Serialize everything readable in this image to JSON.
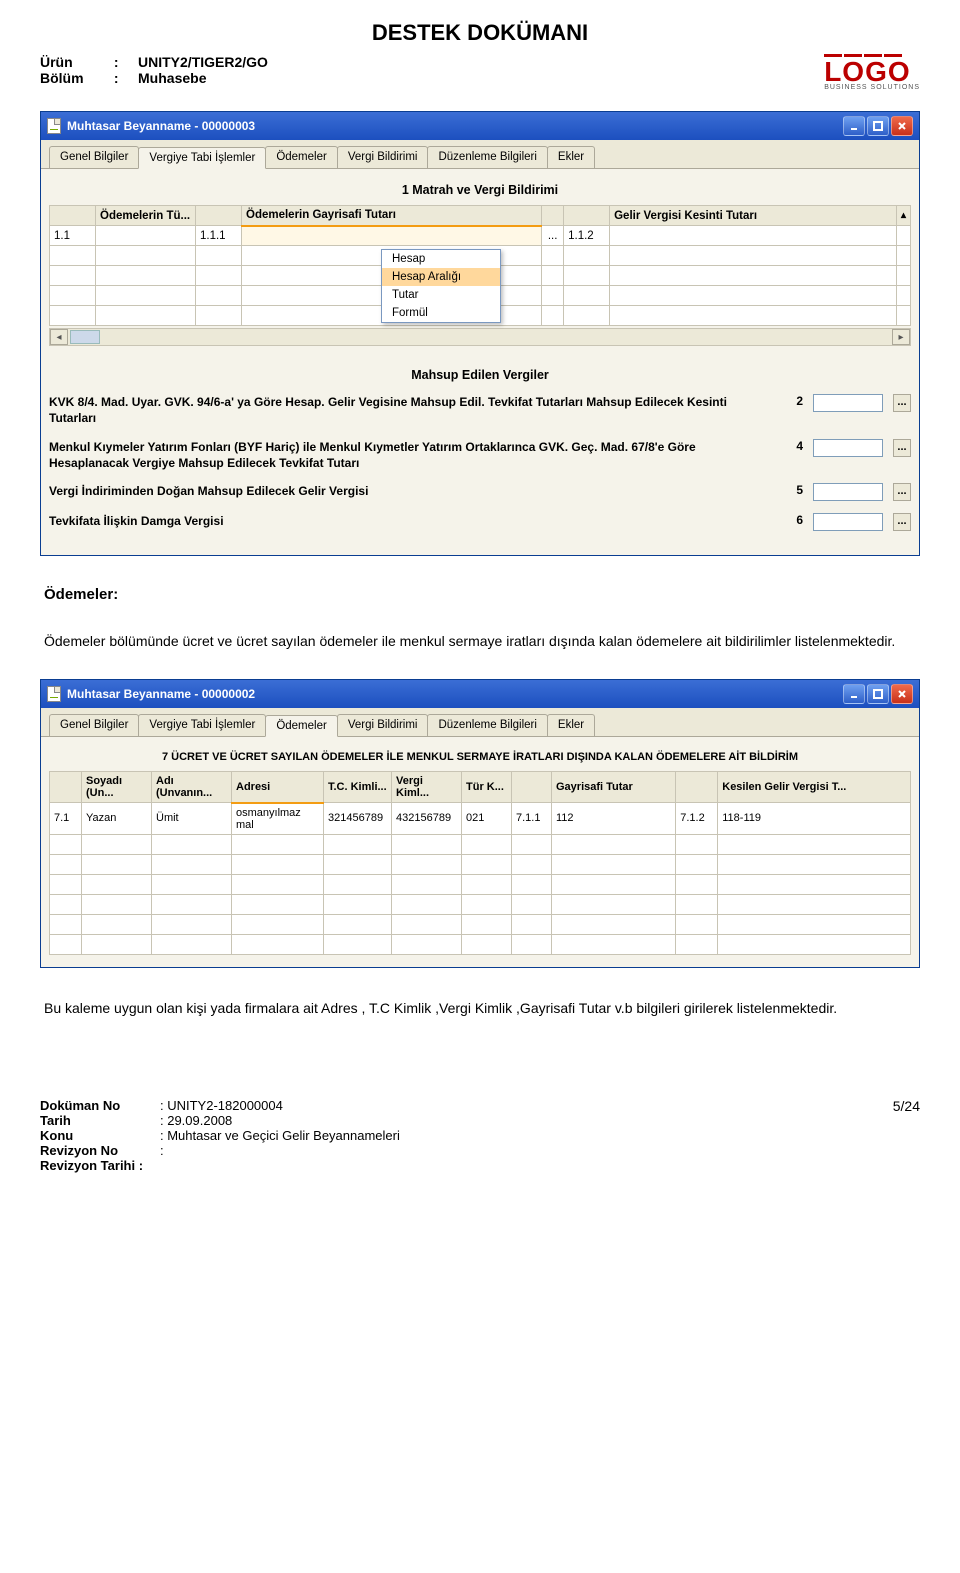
{
  "doc": {
    "title": "DESTEK DOKÜMANI",
    "urun_label": "Ürün",
    "urun_value": "UNITY2/TIGER2/GO",
    "bolum_label": "Bölüm",
    "bolum_value": "Muhasebe",
    "logo_text": "LOGO",
    "logo_sub": "BUSINESS SOLUTIONS"
  },
  "win1": {
    "title": "Muhtasar Beyanname - 00000003",
    "tabs": [
      "Genel Bilgiler",
      "Vergiye Tabi İşlemler",
      "Ödemeler",
      "Vergi Bildirimi",
      "Düzenleme Bilgileri",
      "Ekler"
    ],
    "active_tab_index": 1,
    "section_title": "1 Matrah ve Vergi Bildirimi",
    "columns": [
      "Ödemelerin Tü...",
      "",
      "Ödemelerin Gayrisafi Tutarı",
      "",
      "Gelir Vergisi Kesinti Tutarı"
    ],
    "active_col_index": 2,
    "row1": {
      "c0": "1.1",
      "c1": "1.1.1",
      "c2_right": "...",
      "c3": "1.1.2"
    },
    "context_menu": [
      "Hesap",
      "Hesap Aralığı",
      "Tutar",
      "Formül"
    ],
    "context_selected_index": 1,
    "mahsup_title": "Mahsup Edilen Vergiler",
    "fields": [
      {
        "label": "KVK 8/4. Mad. Uyar. GVK. 94/6-a' ya Göre Hesap. Gelir Vegisine Mahsup Edil. Tevkifat Tutarları Mahsup Edilecek Kesinti Tutarları",
        "num": "2"
      },
      {
        "label": "Menkul Kıymeler Yatırım Fonları (BYF Hariç) ile Menkul Kıymetler Yatırım Ortaklarınca GVK. Geç. Mad. 67/8'e Göre Hesaplanacak Vergiye Mahsup Edilecek Tevkifat Tutarı",
        "num": "4"
      },
      {
        "label": "Vergi İndiriminden Doğan Mahsup Edilecek Gelir Vergisi",
        "num": "5"
      },
      {
        "label": "Tevkifata İlişkin Damga Vergisi",
        "num": "6"
      }
    ]
  },
  "text1": {
    "heading": "Ödemeler:",
    "body": "Ödemeler bölümünde ücret ve ücret sayılan ödemeler ile menkul sermaye iratları dışında kalan ödemelere ait bildirilimler listelenmektedir."
  },
  "win2": {
    "title": "Muhtasar Beyanname - 00000002",
    "tabs": [
      "Genel Bilgiler",
      "Vergiye Tabi İşlemler",
      "Ödemeler",
      "Vergi Bildirimi",
      "Düzenleme Bilgileri",
      "Ekler"
    ],
    "active_tab_index": 2,
    "section_title": "7 ÜCRET VE ÜCRET SAYILAN ÖDEMELER İLE MENKUL SERMAYE İRATLARI DIŞINDA KALAN ÖDEMELERE AİT BİLDİRİM",
    "columns": [
      "",
      "Soyadı (Un...",
      "Adı (Unvanın...",
      "Adresi",
      "T.C. Kimli...",
      "Vergi Kiml...",
      "Tür K...",
      "",
      "Gayrisafi Tutar",
      "",
      "Kesilen Gelir Vergisi T..."
    ],
    "active_col_index": 3,
    "row": {
      "c0": "7.1",
      "c1": "Yazan",
      "c2": "Ümit",
      "c3": "osmanyılmaz mal",
      "c4": "321456789",
      "c5": "432156789",
      "c6": "021",
      "c7": "7.1.1",
      "c8": "112",
      "c9": "7.1.2",
      "c10": "118-119"
    }
  },
  "text2": "Bu kaleme uygun olan kişi yada firmalara ait Adres , T.C Kimlik ,Vergi Kimlik ,Gayrisafi Tutar v.b bilgileri girilerek listelenmektedir.",
  "footer": {
    "dokuman_no_label": "Doküman No",
    "dokuman_no": ": UNITY2-182000004",
    "tarih_label": "Tarih",
    "tarih": ": 29.09.2008",
    "konu_label": "Konu",
    "konu": ": Muhtasar ve Geçici Gelir Beyannameleri",
    "rev_no_label": "Revizyon No",
    "rev_no": ":",
    "rev_tarih_label": "Revizyon Tarihi :",
    "page": "5/24"
  }
}
